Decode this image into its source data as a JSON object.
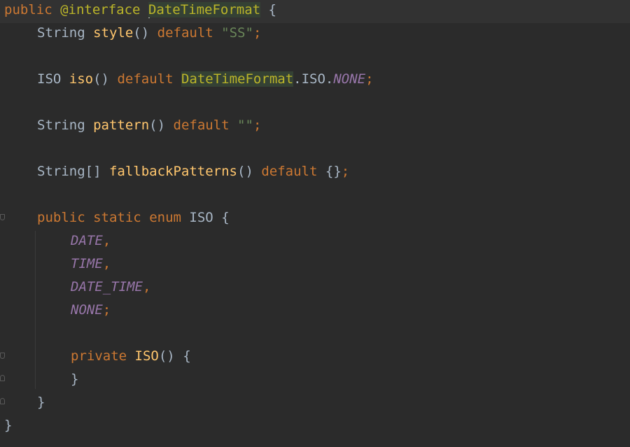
{
  "code": {
    "l1": {
      "t1": "public",
      "t2": "@interface",
      "t3": "DateTimeFormat",
      "t4": "{"
    },
    "l2": {
      "t1": "String",
      "t2": "style",
      "t3": "()",
      "t4": "default",
      "t5": "\"SS\"",
      "t6": ";"
    },
    "l3": {
      "t1": "ISO",
      "t2": "iso",
      "t3": "()",
      "t4": "default",
      "t5": "DateTimeFormat",
      "t6": ".ISO.",
      "t7": "NONE",
      "t8": ";"
    },
    "l4": {
      "t1": "String",
      "t2": "pattern",
      "t3": "()",
      "t4": "default",
      "t5": "\"\"",
      "t6": ";"
    },
    "l5": {
      "t1": "String[]",
      "t2": "fallbackPatterns",
      "t3": "()",
      "t4": "default",
      "t5": "{}",
      "t6": ";"
    },
    "l6": {
      "t1": "public",
      "t2": "static",
      "t3": "enum",
      "t4": "ISO",
      "t5": "{"
    },
    "l7": {
      "t1": "DATE",
      "t2": ","
    },
    "l8": {
      "t1": "TIME",
      "t2": ","
    },
    "l9": {
      "t1": "DATE_TIME",
      "t2": ","
    },
    "l10": {
      "t1": "NONE",
      "t2": ";"
    },
    "l11": {
      "t1": "private",
      "t2": "ISO",
      "t3": "()",
      "t4": "{"
    },
    "l12": {
      "t1": "}"
    },
    "l13": {
      "t1": "}"
    },
    "l14": {
      "t1": "}"
    }
  },
  "icons": {
    "fold_start": "fold-start-icon",
    "fold_end": "fold-end-icon"
  },
  "colors": {
    "background": "#2b2b2b",
    "keyword": "#cc7832",
    "annotation": "#bbb529",
    "method": "#ffc66d",
    "string": "#6a8759",
    "constant": "#9876aa",
    "text": "#a9b7c6"
  }
}
